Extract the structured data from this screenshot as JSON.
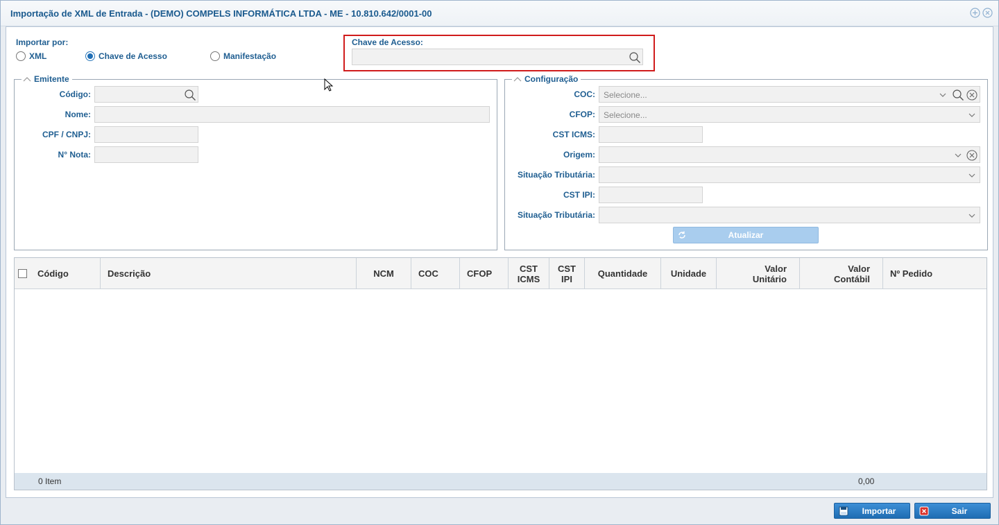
{
  "window": {
    "title": "Importação de XML de Entrada - (DEMO) COMPELS INFORMÁTICA LTDA - ME - 10.810.642/0001-00"
  },
  "import_by": {
    "label": "Importar por:",
    "options": [
      {
        "label": "XML",
        "selected": false
      },
      {
        "label": "Chave de Acesso",
        "selected": true
      },
      {
        "label": "Manifestação",
        "selected": false
      }
    ]
  },
  "access_key": {
    "label": "Chave de Acesso:",
    "value": ""
  },
  "emitente": {
    "legend": "Emitente",
    "codigo_label": "Código:",
    "nome_label": "Nome:",
    "cpf_label": "CPF / CNPJ:",
    "nota_label": "N° Nota:"
  },
  "configuracao": {
    "legend": "Configuração",
    "coc_label": "COC:",
    "coc_placeholder": "Selecione...",
    "cfop_label": "CFOP:",
    "cfop_placeholder": "Selecione...",
    "cst_icms_label": "CST ICMS:",
    "origem_label": "Origem:",
    "sit_trib_label_1": "Situação Tributária:",
    "cst_ipi_label": "CST IPI:",
    "sit_trib_label_2": "Situação Tributária:",
    "update_button": "Atualizar"
  },
  "grid": {
    "columns": [
      {
        "line1": "Código",
        "line2": ""
      },
      {
        "line1": "Descrição",
        "line2": ""
      },
      {
        "line1": "NCM",
        "line2": ""
      },
      {
        "line1": "COC",
        "line2": ""
      },
      {
        "line1": "CFOP",
        "line2": ""
      },
      {
        "line1": "CST",
        "line2": "ICMS"
      },
      {
        "line1": "CST",
        "line2": "IPI"
      },
      {
        "line1": "Quantidade",
        "line2": ""
      },
      {
        "line1": "Unidade",
        "line2": ""
      },
      {
        "line1": "Valor",
        "line2": "Unitário"
      },
      {
        "line1": "Valor",
        "line2": "Contábil"
      },
      {
        "line1": "Nº Pedido",
        "line2": ""
      }
    ],
    "footer_count": "0 Item",
    "footer_total": "0,00"
  },
  "buttons": {
    "import": "Importar",
    "exit": "Sair"
  },
  "colors": {
    "accent": "#1f5e91",
    "highlight": "#d01b1b",
    "button": "#2a7cc4"
  }
}
